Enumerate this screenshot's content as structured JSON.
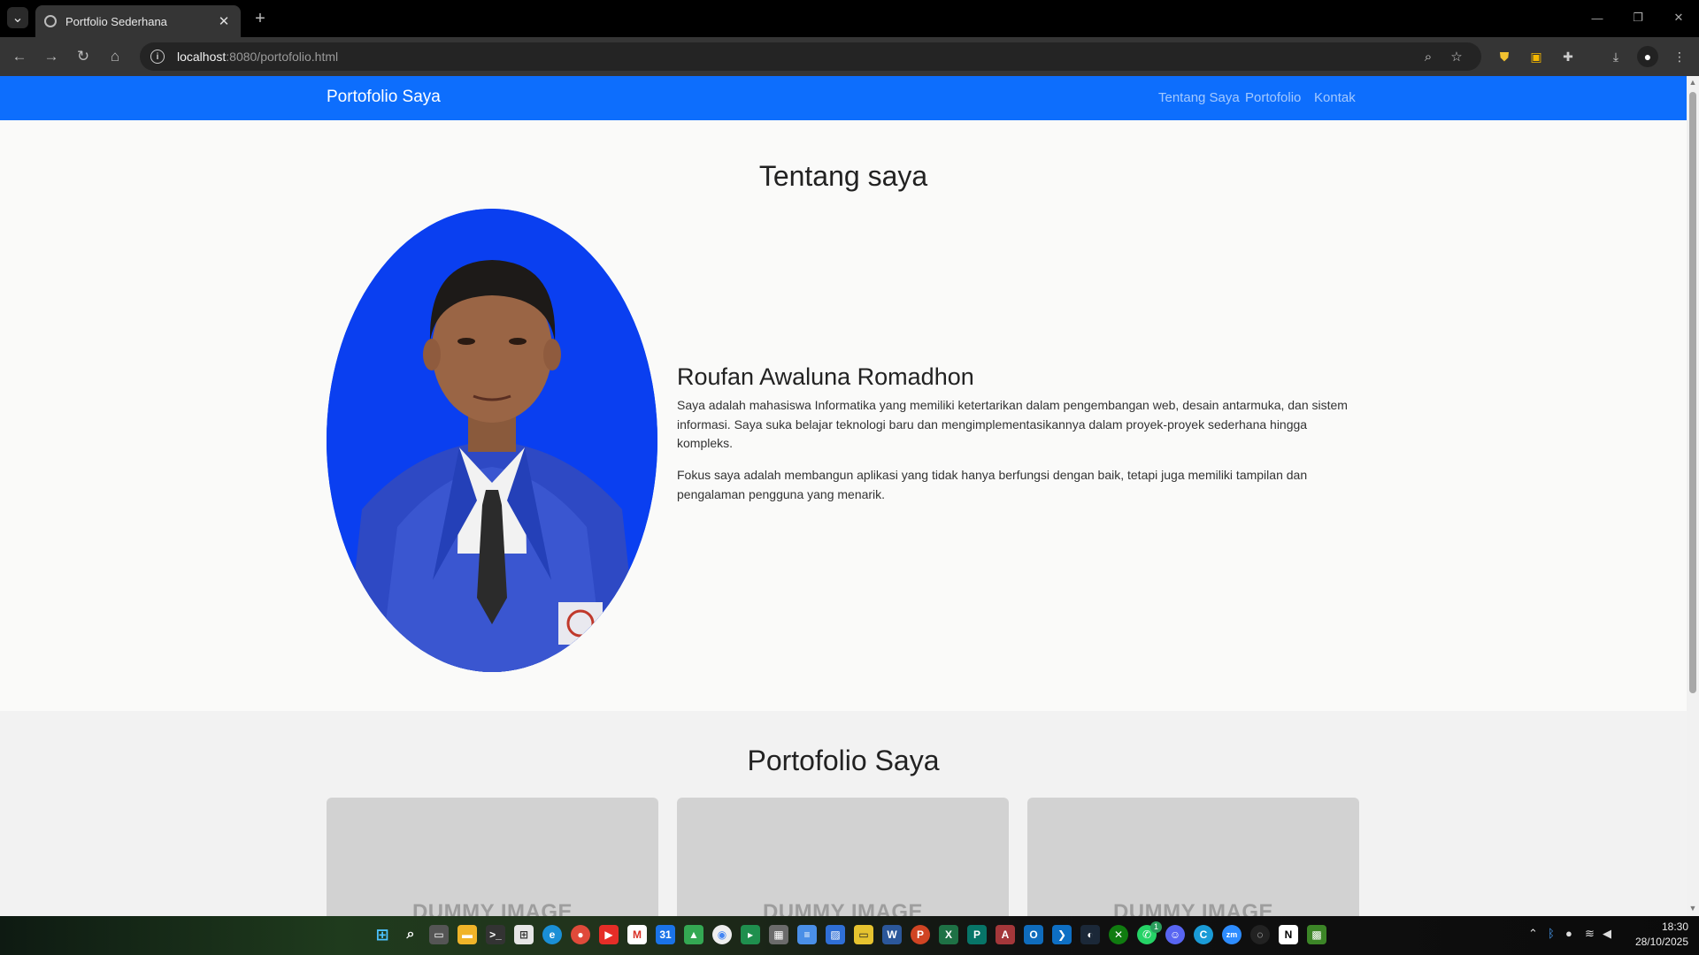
{
  "browser": {
    "tab_title": "Portfolio Sederhana",
    "url_host": "localhost",
    "url_rest": ":8080/portofolio.html"
  },
  "site": {
    "brand": "Portofolio Saya",
    "nav": [
      "Tentang Saya",
      "Portofolio",
      "Kontak"
    ]
  },
  "about": {
    "heading": "Tentang saya",
    "name": "Roufan Awaluna Romadhon",
    "paragraphs": [
      "Saya adalah mahasiswa Informatika yang memiliki ketertarikan dalam pengembangan web, desain antarmuka, dan sistem informasi. Saya suka belajar teknologi baru dan mengimplementasikannya dalam proyek-proyek sederhana hingga kompleks.",
      "Fokus saya adalah membangun aplikasi yang tidak hanya berfungsi dengan baik, tetapi juga memiliki tampilan dan pengalaman pengguna yang menarik."
    ]
  },
  "portfolio": {
    "heading": "Portofolio Saya",
    "card_placeholder": "DUMMY IMAGE"
  },
  "taskbar": {
    "time": "18:30",
    "date": "28/10/2025",
    "whatsapp_badge": "1"
  },
  "colors": {
    "navbar": "#0d6efd",
    "photo_bg": "#0a3ff0",
    "page_bg": "#fafaf9"
  }
}
